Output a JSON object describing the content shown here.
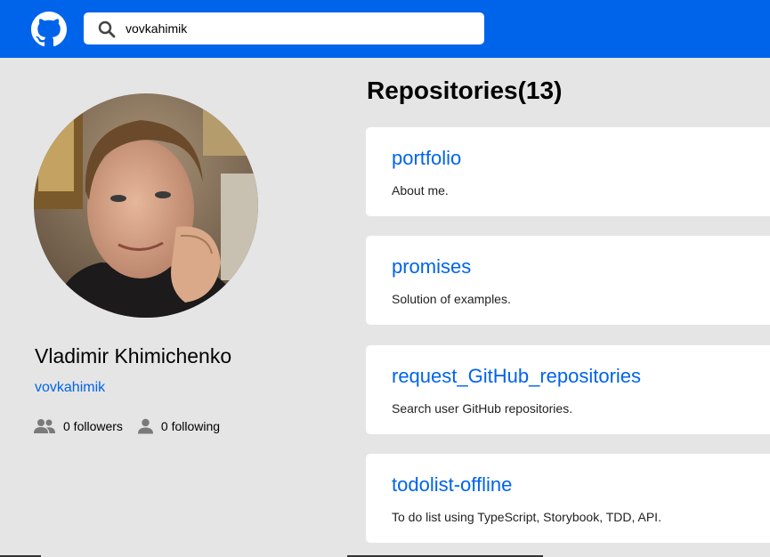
{
  "header": {
    "logo_icon": "github-icon",
    "search": {
      "icon": "search-icon",
      "value": "vovkahimik"
    }
  },
  "profile": {
    "name": "Vladimir Khimichenko",
    "login": "vovkahimik",
    "followers_label": "0 followers",
    "following_label": "0 following",
    "followers_icon": "people-icon",
    "following_icon": "person-icon"
  },
  "repositories": {
    "title": "Repositories(13)",
    "items": [
      {
        "name": "portfolio",
        "description": "About me."
      },
      {
        "name": "promises",
        "description": "Solution of examples."
      },
      {
        "name": "request_GitHub_repositories",
        "description": "Search user GitHub repositories."
      },
      {
        "name": "todolist-offline",
        "description": "To do list using TypeScript, Storybook, TDD, API."
      }
    ]
  },
  "colors": {
    "header_bg": "#0064eb",
    "page_bg": "#e5e5e5",
    "link": "#0064eb",
    "card_bg": "#ffffff"
  }
}
